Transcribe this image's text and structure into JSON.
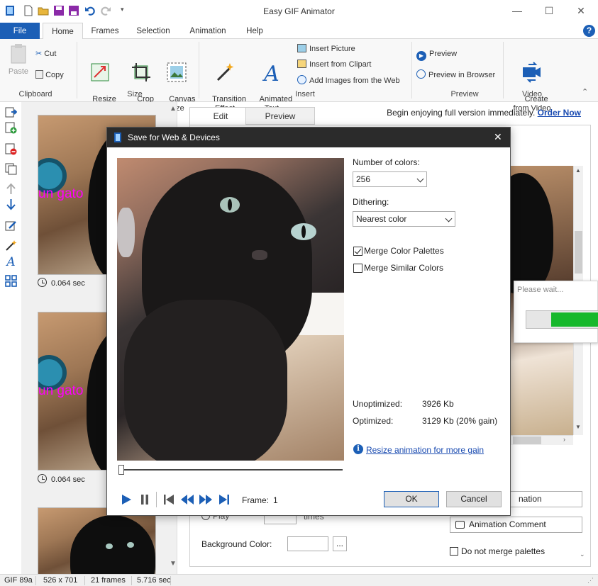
{
  "window": {
    "title": "Easy GIF Animator"
  },
  "ribbon_tabs": [
    "File",
    "Home",
    "Frames",
    "Selection",
    "Animation",
    "Help"
  ],
  "ribbon": {
    "clipboard": {
      "paste": "Paste",
      "cut": "Cut",
      "copy": "Copy",
      "group": "Clipboard"
    },
    "size": {
      "resize": "Resize\nAnimation",
      "crop": "Crop\nEdges",
      "canvas": "Canvas\nSize",
      "group": "Size"
    },
    "insert": {
      "transition": "Transition\nEffect",
      "animated_text": "Animated\nText",
      "insert_picture": "Insert Picture",
      "insert_clipart": "Insert from Clipart",
      "add_web": "Add Images from the Web",
      "group": "Insert"
    },
    "preview": {
      "preview": "Preview",
      "preview_browser": "Preview in Browser",
      "group": "Preview"
    },
    "video": {
      "create": "Create\nfrom Video",
      "group": "Video"
    }
  },
  "frames": [
    {
      "caption": "un gato",
      "delay": "0.064 sec"
    },
    {
      "caption": "un gato",
      "delay": "0.064 sec"
    },
    {
      "caption": "",
      "delay": ""
    }
  ],
  "editor_tabs": {
    "edit": "Edit",
    "preview": "Preview"
  },
  "promo": {
    "text": "Begin enjoying full version immediately.",
    "link": "Order Now"
  },
  "dialog": {
    "title": "Save for Web & Devices",
    "num_colors_label": "Number of colors:",
    "num_colors_value": "256",
    "dithering_label": "Dithering:",
    "dithering_value": "Nearest color",
    "merge_palettes": "Merge Color Palettes",
    "merge_palettes_checked": true,
    "merge_similar": "Merge Similar Colors",
    "merge_similar_checked": false,
    "unoptimized_label": "Unoptimized:",
    "unoptimized_value": "3926 Kb",
    "optimized_label": "Optimized:",
    "optimized_value": "3129 Kb (20% gain)",
    "resize_link": "Resize animation for more gain",
    "frame_label": "Frame:",
    "frame_value": "1",
    "ok": "OK",
    "cancel": "Cancel"
  },
  "wait": {
    "text": "Please wait...",
    "progress": 0.6
  },
  "behind_panel": {
    "anim_btn": "nation",
    "anim_comment": "Animation Comment",
    "play_label": "Play",
    "times_label": "times",
    "bg_color_label": "Background Color:",
    "bg_color_btn": "...",
    "no_merge": "Do not merge palettes"
  },
  "status": {
    "format": "GIF 89a",
    "size": "526 x 701",
    "frames": "21 frames",
    "duration": "5.716 sec"
  },
  "colors": {
    "accent": "#1c5fb6",
    "link": "#1a4bb1",
    "progress": "#17b82c",
    "text_overlay": "#ff00ff"
  }
}
